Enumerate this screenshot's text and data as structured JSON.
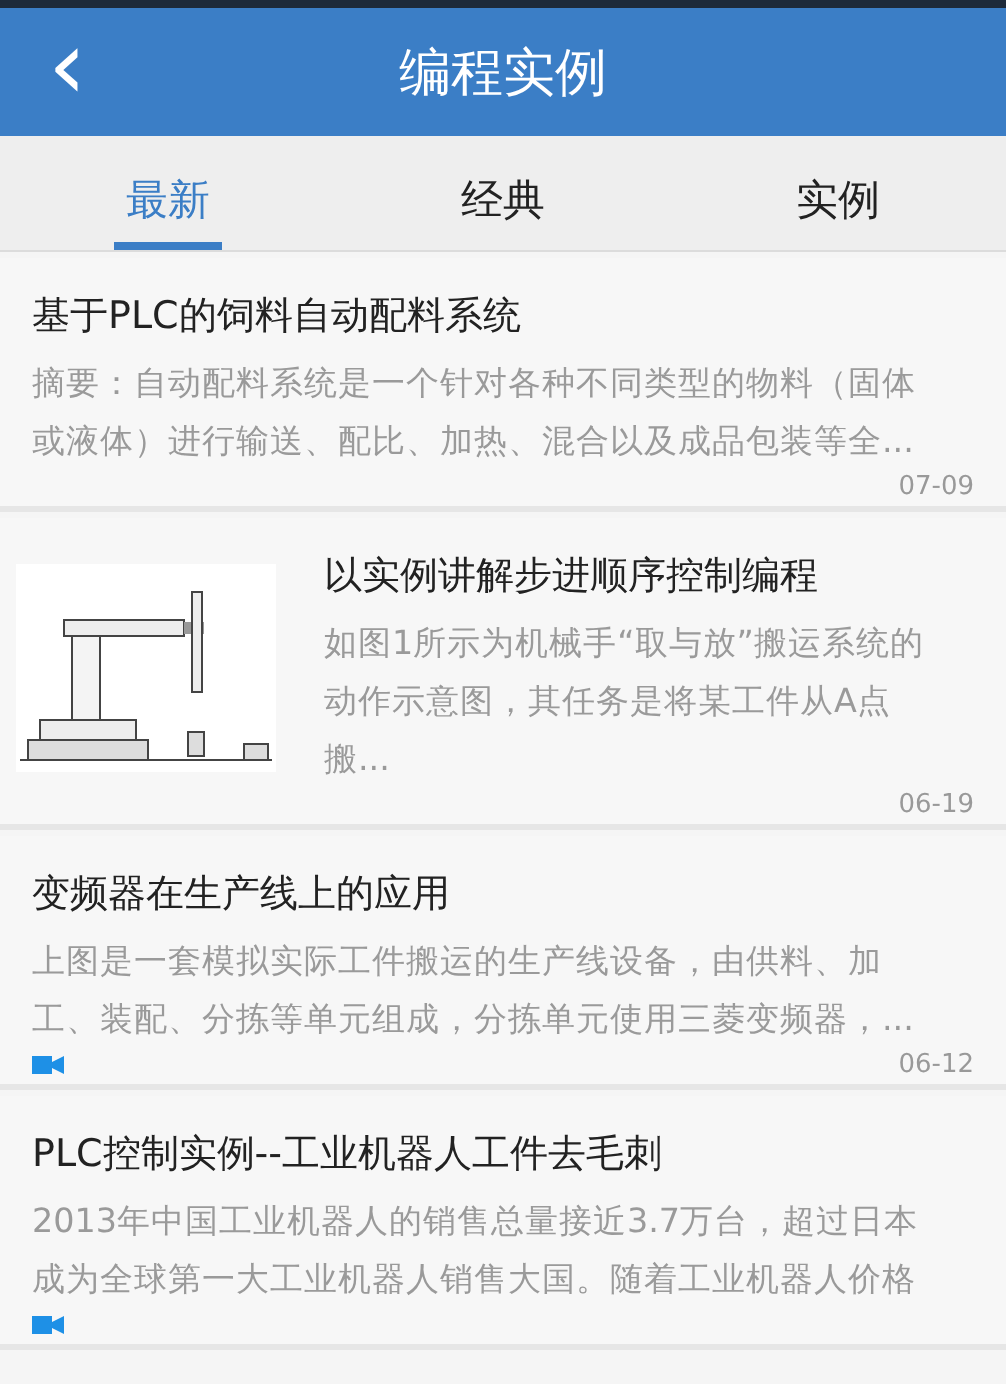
{
  "header": {
    "back_icon": "‹",
    "title": "编程实例"
  },
  "tabs": [
    {
      "label": "最新",
      "selected": true
    },
    {
      "label": "经典",
      "selected": false
    },
    {
      "label": "实例",
      "selected": false
    }
  ],
  "articles": [
    {
      "kind": "text",
      "title": "基于PLC的饲料自动配料系统",
      "summary": "摘要：自动配料系统是一个针对各种不同类型的物料（固体或液体）进行输送、配比、加热、混合以及成品包装等全...",
      "date": "07-09",
      "video": false
    },
    {
      "kind": "picture",
      "title": "以实例讲解步进顺序控制编程",
      "summary": "如图1所示为机械手“取与放”搬运系统的动作示意图，其任务是将某工件从A点搬...",
      "date": "06-19",
      "video": false
    },
    {
      "kind": "text",
      "title": "变频器在生产线上的应用",
      "summary": "上图是一套模拟实际工件搬运的生产线设备，由供料、加工、装配、分拣等单元组成，分拣单元使用三菱变频器，...",
      "date": "06-12",
      "video": true
    },
    {
      "kind": "text",
      "title": "PLC控制实例--工业机器人工件去毛刺",
      "summary": "2013年中国工业机器人的销售总量接近3.7万台，超过日本成为全球第一大工业机器人销售大国。随着工业机器人价格",
      "video": true
    }
  ]
}
